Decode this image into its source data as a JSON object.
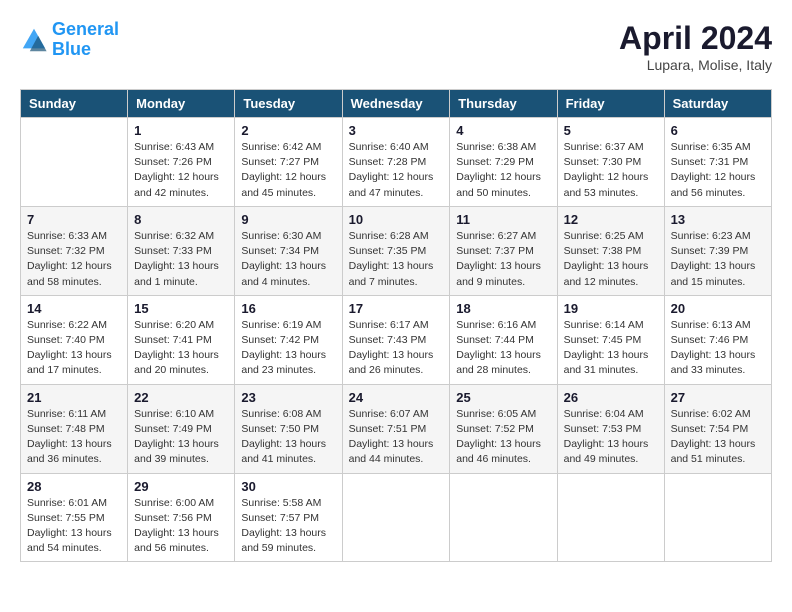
{
  "header": {
    "logo_line1": "General",
    "logo_line2": "Blue",
    "month_title": "April 2024",
    "subtitle": "Lupara, Molise, Italy"
  },
  "weekdays": [
    "Sunday",
    "Monday",
    "Tuesday",
    "Wednesday",
    "Thursday",
    "Friday",
    "Saturday"
  ],
  "weeks": [
    [
      {
        "day": "",
        "info": ""
      },
      {
        "day": "1",
        "info": "Sunrise: 6:43 AM\nSunset: 7:26 PM\nDaylight: 12 hours\nand 42 minutes."
      },
      {
        "day": "2",
        "info": "Sunrise: 6:42 AM\nSunset: 7:27 PM\nDaylight: 12 hours\nand 45 minutes."
      },
      {
        "day": "3",
        "info": "Sunrise: 6:40 AM\nSunset: 7:28 PM\nDaylight: 12 hours\nand 47 minutes."
      },
      {
        "day": "4",
        "info": "Sunrise: 6:38 AM\nSunset: 7:29 PM\nDaylight: 12 hours\nand 50 minutes."
      },
      {
        "day": "5",
        "info": "Sunrise: 6:37 AM\nSunset: 7:30 PM\nDaylight: 12 hours\nand 53 minutes."
      },
      {
        "day": "6",
        "info": "Sunrise: 6:35 AM\nSunset: 7:31 PM\nDaylight: 12 hours\nand 56 minutes."
      }
    ],
    [
      {
        "day": "7",
        "info": "Sunrise: 6:33 AM\nSunset: 7:32 PM\nDaylight: 12 hours\nand 58 minutes."
      },
      {
        "day": "8",
        "info": "Sunrise: 6:32 AM\nSunset: 7:33 PM\nDaylight: 13 hours\nand 1 minute."
      },
      {
        "day": "9",
        "info": "Sunrise: 6:30 AM\nSunset: 7:34 PM\nDaylight: 13 hours\nand 4 minutes."
      },
      {
        "day": "10",
        "info": "Sunrise: 6:28 AM\nSunset: 7:35 PM\nDaylight: 13 hours\nand 7 minutes."
      },
      {
        "day": "11",
        "info": "Sunrise: 6:27 AM\nSunset: 7:37 PM\nDaylight: 13 hours\nand 9 minutes."
      },
      {
        "day": "12",
        "info": "Sunrise: 6:25 AM\nSunset: 7:38 PM\nDaylight: 13 hours\nand 12 minutes."
      },
      {
        "day": "13",
        "info": "Sunrise: 6:23 AM\nSunset: 7:39 PM\nDaylight: 13 hours\nand 15 minutes."
      }
    ],
    [
      {
        "day": "14",
        "info": "Sunrise: 6:22 AM\nSunset: 7:40 PM\nDaylight: 13 hours\nand 17 minutes."
      },
      {
        "day": "15",
        "info": "Sunrise: 6:20 AM\nSunset: 7:41 PM\nDaylight: 13 hours\nand 20 minutes."
      },
      {
        "day": "16",
        "info": "Sunrise: 6:19 AM\nSunset: 7:42 PM\nDaylight: 13 hours\nand 23 minutes."
      },
      {
        "day": "17",
        "info": "Sunrise: 6:17 AM\nSunset: 7:43 PM\nDaylight: 13 hours\nand 26 minutes."
      },
      {
        "day": "18",
        "info": "Sunrise: 6:16 AM\nSunset: 7:44 PM\nDaylight: 13 hours\nand 28 minutes."
      },
      {
        "day": "19",
        "info": "Sunrise: 6:14 AM\nSunset: 7:45 PM\nDaylight: 13 hours\nand 31 minutes."
      },
      {
        "day": "20",
        "info": "Sunrise: 6:13 AM\nSunset: 7:46 PM\nDaylight: 13 hours\nand 33 minutes."
      }
    ],
    [
      {
        "day": "21",
        "info": "Sunrise: 6:11 AM\nSunset: 7:48 PM\nDaylight: 13 hours\nand 36 minutes."
      },
      {
        "day": "22",
        "info": "Sunrise: 6:10 AM\nSunset: 7:49 PM\nDaylight: 13 hours\nand 39 minutes."
      },
      {
        "day": "23",
        "info": "Sunrise: 6:08 AM\nSunset: 7:50 PM\nDaylight: 13 hours\nand 41 minutes."
      },
      {
        "day": "24",
        "info": "Sunrise: 6:07 AM\nSunset: 7:51 PM\nDaylight: 13 hours\nand 44 minutes."
      },
      {
        "day": "25",
        "info": "Sunrise: 6:05 AM\nSunset: 7:52 PM\nDaylight: 13 hours\nand 46 minutes."
      },
      {
        "day": "26",
        "info": "Sunrise: 6:04 AM\nSunset: 7:53 PM\nDaylight: 13 hours\nand 49 minutes."
      },
      {
        "day": "27",
        "info": "Sunrise: 6:02 AM\nSunset: 7:54 PM\nDaylight: 13 hours\nand 51 minutes."
      }
    ],
    [
      {
        "day": "28",
        "info": "Sunrise: 6:01 AM\nSunset: 7:55 PM\nDaylight: 13 hours\nand 54 minutes."
      },
      {
        "day": "29",
        "info": "Sunrise: 6:00 AM\nSunset: 7:56 PM\nDaylight: 13 hours\nand 56 minutes."
      },
      {
        "day": "30",
        "info": "Sunrise: 5:58 AM\nSunset: 7:57 PM\nDaylight: 13 hours\nand 59 minutes."
      },
      {
        "day": "",
        "info": ""
      },
      {
        "day": "",
        "info": ""
      },
      {
        "day": "",
        "info": ""
      },
      {
        "day": "",
        "info": ""
      }
    ]
  ]
}
